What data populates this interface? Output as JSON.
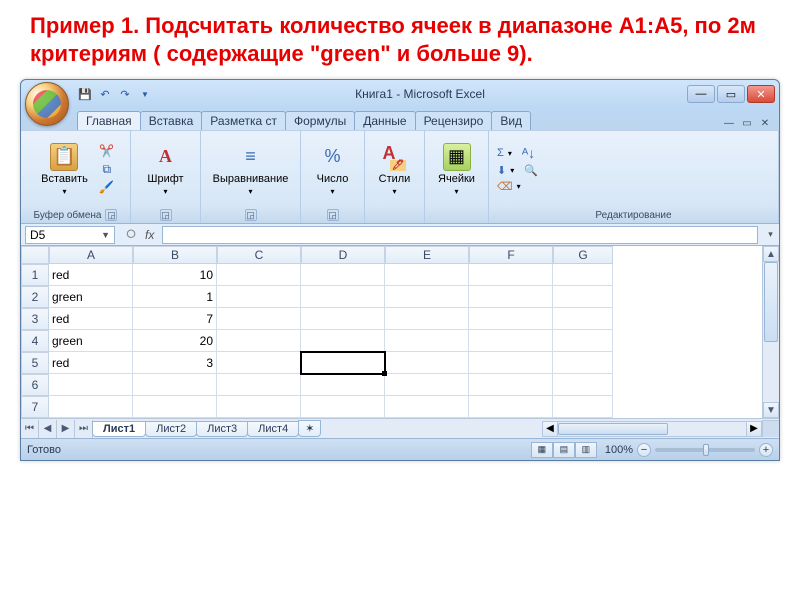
{
  "task_text": "Пример 1. Подсчитать количество ячеек в диапазоне А1:А5, по 2м критериям ( содержащие \"green\"  и  больше 9).",
  "title": "Книга1 - Microsoft Excel",
  "tabs": [
    "Главная",
    "Вставка",
    "Разметка ст",
    "Формулы",
    "Данные",
    "Рецензиро",
    "Вид"
  ],
  "ribbon": {
    "clipboard": {
      "paste": "Вставить",
      "label": "Буфер обмена"
    },
    "font": {
      "btn": "Шрифт",
      "label": ""
    },
    "align": {
      "btn": "Выравнивание",
      "label": ""
    },
    "number": {
      "btn": "Число",
      "label": ""
    },
    "styles": {
      "btn": "Стили",
      "label": ""
    },
    "cells": {
      "btn": "Ячейки",
      "label": ""
    },
    "editing": {
      "label": "Редактирование"
    }
  },
  "namebox": "D5",
  "formula": "",
  "columns": [
    "A",
    "B",
    "C",
    "D",
    "E",
    "F",
    "G"
  ],
  "rows": [
    1,
    2,
    3,
    4,
    5,
    6,
    7
  ],
  "chart_data": {
    "type": "table",
    "columns": [
      "A",
      "B"
    ],
    "rows": [
      [
        "red",
        10
      ],
      [
        "green",
        1
      ],
      [
        "red",
        7
      ],
      [
        "green",
        20
      ],
      [
        "red",
        3
      ]
    ]
  },
  "active_cell": "D5",
  "sheets": [
    "Лист1",
    "Лист2",
    "Лист3",
    "Лист4"
  ],
  "status": "Готово",
  "zoom": "100%"
}
